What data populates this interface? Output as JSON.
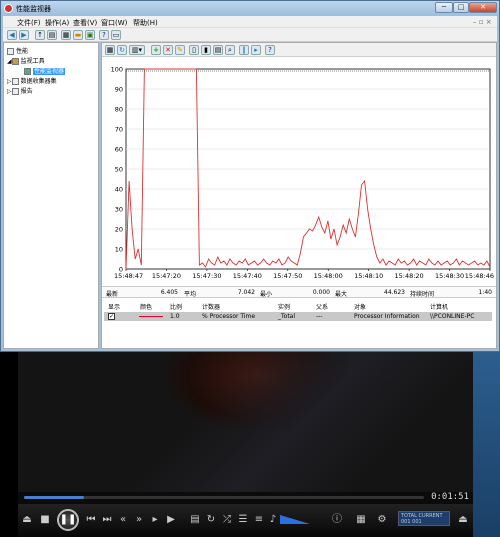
{
  "window": {
    "title": "性能监视器",
    "controls": [
      "─",
      "□",
      "✕"
    ]
  },
  "menu": [
    "文件(F)",
    "操作(A)",
    "查看(V)",
    "窗口(W)",
    "帮助(H)"
  ],
  "tree": [
    {
      "label": "性能",
      "expander": ""
    },
    {
      "label": "监视工具",
      "expander": "◢"
    },
    {
      "label": "性能监视器",
      "expander": ""
    },
    {
      "label": "数据收集器集",
      "expander": "▷"
    },
    {
      "label": "报告",
      "expander": "▷"
    }
  ],
  "chart_data": {
    "type": "line",
    "series": [
      {
        "color": "#e03030",
        "values": [
          0,
          44,
          20,
          5,
          10,
          2,
          100,
          100,
          100,
          100,
          100,
          100,
          100,
          100,
          100,
          100,
          100,
          100,
          100,
          100,
          100,
          100,
          100,
          100,
          2,
          3,
          1,
          5,
          3,
          2,
          6,
          3,
          4,
          2,
          5,
          3,
          2,
          4,
          3,
          5,
          2,
          3,
          4,
          2,
          3,
          5,
          3,
          2,
          4,
          3,
          5,
          2,
          3,
          6,
          4,
          3,
          2,
          8,
          16,
          18,
          20,
          19,
          22,
          26,
          21,
          18,
          24,
          15,
          20,
          12,
          16,
          22,
          18,
          25,
          20,
          16,
          28,
          42,
          44,
          30,
          20,
          12,
          6,
          3,
          5,
          2,
          4,
          3,
          2,
          5,
          3,
          4,
          2,
          3,
          5,
          2,
          4,
          3,
          2,
          5,
          3,
          2,
          4,
          2,
          3,
          4,
          2,
          3,
          5,
          2,
          4,
          3,
          2,
          3,
          4,
          2,
          3,
          2,
          4,
          1
        ]
      }
    ],
    "x_ticks": [
      "15:48:47",
      "15:47:20",
      "15:47:30",
      "15:47:40",
      "15:47:50",
      "15:48:00",
      "15:48:10",
      "15:48:20",
      "15:48:30",
      "15:48:46"
    ],
    "y_ticks": [
      100,
      90,
      80,
      70,
      60,
      50,
      40,
      30,
      20,
      10,
      0
    ],
    "ylim": [
      0,
      100
    ]
  },
  "stats": {
    "last_label": "最新",
    "last": "6.405",
    "avg_label": "平均",
    "avg": "7.042",
    "min_label": "最小",
    "min": "0.000",
    "max_label": "最大",
    "max": "44.623",
    "dur_label": "持续时间",
    "dur": "1:40"
  },
  "legend": {
    "headers": [
      "显示",
      "颜色",
      "比例",
      "计数器",
      "实例",
      "父系",
      "对象",
      "计算机"
    ],
    "row": {
      "scale": "1.0",
      "counter": "% Processor Time",
      "instance": "_Total",
      "parent": "---",
      "object": "Processor Information",
      "computer": "\\\\PCONLINE-PC"
    }
  },
  "player": {
    "time": "0:01:51",
    "progress": 0.15,
    "badge_total": "TOTAL",
    "badge_current": "CURRENT",
    "badge_vals": "001 001"
  }
}
